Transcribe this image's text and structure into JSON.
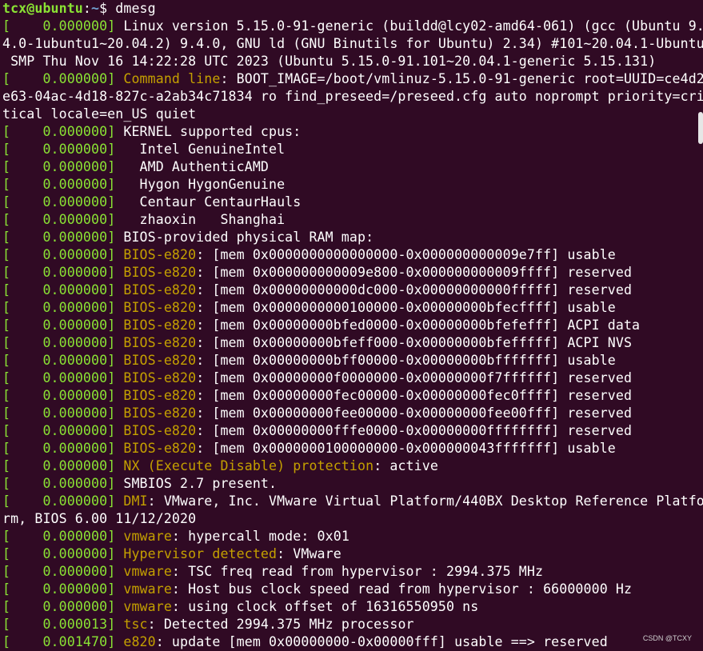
{
  "prompt": {
    "user_host": "tcx@ubuntu",
    "colon": ":",
    "path": "~",
    "symbol": "$",
    "command": "dmesg"
  },
  "colors": {
    "background": "#300a24",
    "green": "#8ae234",
    "yellow": "#c4a000",
    "blue": "#729fcf",
    "white": "#ffffff"
  },
  "lines": [
    {
      "ts": "    0.000000",
      "fac": "",
      "text": "Linux version 5.15.0-91-generic (buildd@lcy02-amd64-061) (gcc (Ubuntu 9."
    },
    {
      "raw": "4.0-1ubuntu1~20.04.2) 9.4.0, GNU ld (GNU Binutils for Ubuntu) 2.34) #101~20.04.1-Ubuntu"
    },
    {
      "raw": " SMP Thu Nov 16 14:22:28 UTC 2023 (Ubuntu 5.15.0-91.101~20.04.1-generic 5.15.131)"
    },
    {
      "ts": "    0.000000",
      "fac": "Command line",
      "text": ": BOOT_IMAGE=/boot/vmlinuz-5.15.0-91-generic root=UUID=ce4d2"
    },
    {
      "raw": "e63-04ac-4d18-827c-a2ab34c71834 ro find_preseed=/preseed.cfg auto noprompt priority=cri"
    },
    {
      "raw": "tical locale=en_US quiet"
    },
    {
      "ts": "    0.000000",
      "fac": "",
      "text": "KERNEL supported cpus:"
    },
    {
      "ts": "    0.000000",
      "fac": "",
      "text": "  Intel GenuineIntel"
    },
    {
      "ts": "    0.000000",
      "fac": "",
      "text": "  AMD AuthenticAMD"
    },
    {
      "ts": "    0.000000",
      "fac": "",
      "text": "  Hygon HygonGenuine"
    },
    {
      "ts": "    0.000000",
      "fac": "",
      "text": "  Centaur CentaurHauls"
    },
    {
      "ts": "    0.000000",
      "fac": "",
      "text": "  zhaoxin   Shanghai"
    },
    {
      "ts": "    0.000000",
      "fac": "",
      "text": "BIOS-provided physical RAM map:"
    },
    {
      "ts": "    0.000000",
      "fac": "BIOS-e820",
      "text": ": [mem 0x0000000000000000-0x000000000009e7ff] usable"
    },
    {
      "ts": "    0.000000",
      "fac": "BIOS-e820",
      "text": ": [mem 0x000000000009e800-0x000000000009ffff] reserved"
    },
    {
      "ts": "    0.000000",
      "fac": "BIOS-e820",
      "text": ": [mem 0x00000000000dc000-0x00000000000fffff] reserved"
    },
    {
      "ts": "    0.000000",
      "fac": "BIOS-e820",
      "text": ": [mem 0x0000000000100000-0x00000000bfecffff] usable"
    },
    {
      "ts": "    0.000000",
      "fac": "BIOS-e820",
      "text": ": [mem 0x00000000bfed0000-0x00000000bfefefff] ACPI data"
    },
    {
      "ts": "    0.000000",
      "fac": "BIOS-e820",
      "text": ": [mem 0x00000000bfeff000-0x00000000bfefffff] ACPI NVS"
    },
    {
      "ts": "    0.000000",
      "fac": "BIOS-e820",
      "text": ": [mem 0x00000000bff00000-0x00000000bfffffff] usable"
    },
    {
      "ts": "    0.000000",
      "fac": "BIOS-e820",
      "text": ": [mem 0x00000000f0000000-0x00000000f7ffffff] reserved"
    },
    {
      "ts": "    0.000000",
      "fac": "BIOS-e820",
      "text": ": [mem 0x00000000fec00000-0x00000000fec0ffff] reserved"
    },
    {
      "ts": "    0.000000",
      "fac": "BIOS-e820",
      "text": ": [mem 0x00000000fee00000-0x00000000fee00fff] reserved"
    },
    {
      "ts": "    0.000000",
      "fac": "BIOS-e820",
      "text": ": [mem 0x00000000fffe0000-0x00000000ffffffff] reserved"
    },
    {
      "ts": "    0.000000",
      "fac": "BIOS-e820",
      "text": ": [mem 0x0000000100000000-0x000000043fffffff] usable"
    },
    {
      "ts": "    0.000000",
      "fac": "NX (Execute Disable) protection",
      "text": ": active"
    },
    {
      "ts": "    0.000000",
      "fac": "",
      "text": "SMBIOS 2.7 present."
    },
    {
      "ts": "    0.000000",
      "fac": "DMI",
      "text": ": VMware, Inc. VMware Virtual Platform/440BX Desktop Reference Platfo"
    },
    {
      "raw": "rm, BIOS 6.00 11/12/2020"
    },
    {
      "ts": "    0.000000",
      "fac": "vmware",
      "text": ": hypercall mode: 0x01"
    },
    {
      "ts": "    0.000000",
      "fac": "Hypervisor detected",
      "text": ": VMware"
    },
    {
      "ts": "    0.000000",
      "fac": "vmware",
      "text": ": TSC freq read from hypervisor : 2994.375 MHz"
    },
    {
      "ts": "    0.000000",
      "fac": "vmware",
      "text": ": Host bus clock speed read from hypervisor : 66000000 Hz"
    },
    {
      "ts": "    0.000000",
      "fac": "vmware",
      "text": ": using clock offset of 16316550950 ns"
    },
    {
      "ts": "    0.000013",
      "fac": "tsc",
      "text": ": Detected 2994.375 MHz processor"
    },
    {
      "ts": "    0.001470",
      "fac": "e820",
      "text": ": update [mem 0x00000000-0x00000fff] usable ==> reserved"
    }
  ],
  "watermark": "CSDN @TCXY"
}
